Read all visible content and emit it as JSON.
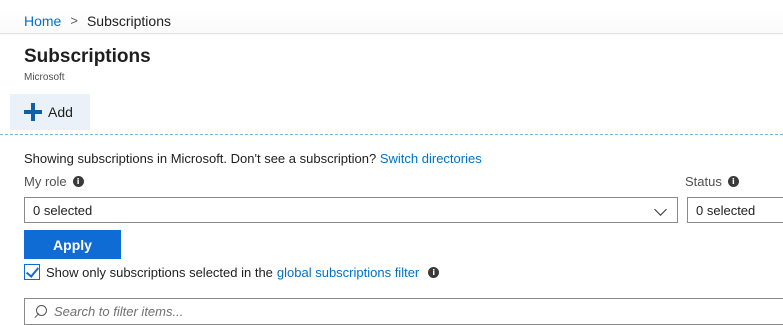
{
  "breadcrumb": {
    "home_label": "Home",
    "separator": ">",
    "current_label": "Subscriptions"
  },
  "header": {
    "title": "Subscriptions",
    "subtitle": "Microsoft"
  },
  "toolbar": {
    "add_label": "Add",
    "add_icon": "plus-icon",
    "accent_color": "#0f5ea8"
  },
  "info": {
    "text": "Showing subscriptions in Microsoft. Don't see a subscription?",
    "link_label": "Switch directories"
  },
  "filters": {
    "my_role": {
      "label": "My role",
      "value": "0 selected"
    },
    "status": {
      "label": "Status",
      "value": "0 selected"
    },
    "info_icon_glyph": "i"
  },
  "actions": {
    "apply_label": "Apply",
    "apply_color": "#0f6cd4"
  },
  "global_filter": {
    "checked": true,
    "text": "Show only subscriptions selected in the",
    "link_label": "global subscriptions filter"
  },
  "search": {
    "placeholder": "Search to filter items..."
  }
}
